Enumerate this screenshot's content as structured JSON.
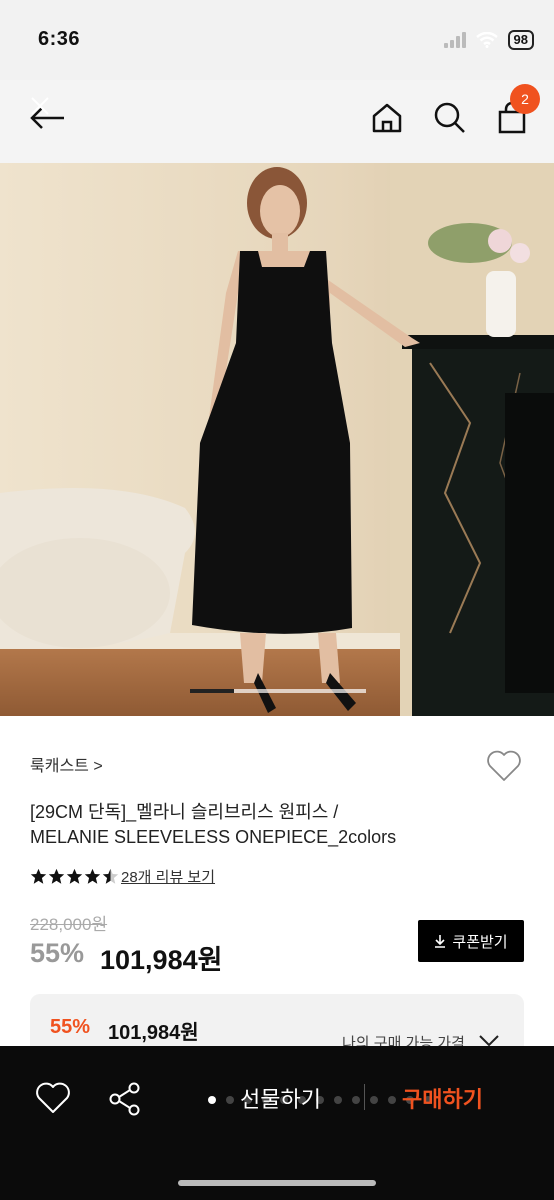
{
  "status_bar": {
    "time": "6:36",
    "battery": "98"
  },
  "nav": {
    "cart_count": "2"
  },
  "product": {
    "image_slider_progress": 0.25,
    "brand": "룩캐스트 >",
    "title_line1": "[29CM 단독]_멜라니 슬리브리스 원피스 /",
    "title_line2": "MELANIE SLEEVELESS ONEPIECE_2colors",
    "rating": 4.5,
    "review_link": "28개 리뷰 보기",
    "original_price": "228,000원",
    "discount": "55%",
    "sale_price": "101,984원",
    "coupon_button": "쿠폰받기"
  },
  "price_box": {
    "discount": "55%",
    "price": "101,984원",
    "link": "나의 구매 가능 가격"
  },
  "bottom_bar": {
    "gift_button": "선물하기",
    "buy_button": "구매하기"
  },
  "colors": {
    "accent": "#f0521f",
    "dark": "#0b0b0b"
  }
}
